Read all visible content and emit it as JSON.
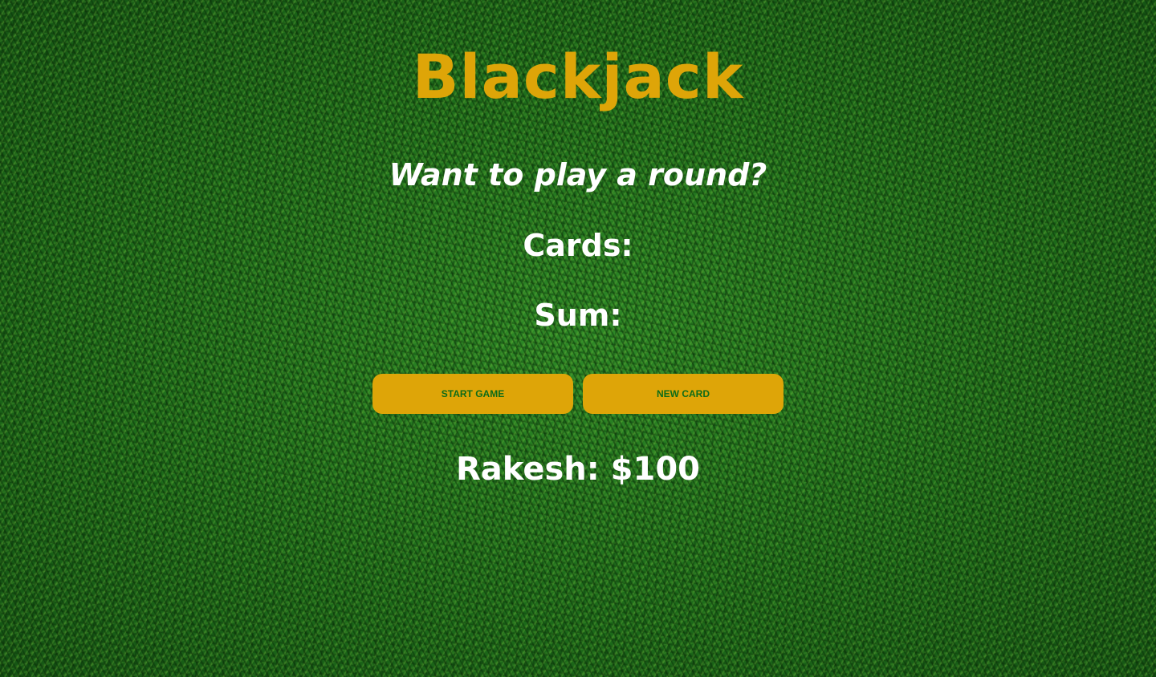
{
  "game": {
    "title": "Blackjack",
    "message": "Want to play a round?",
    "cards_label": "Cards:",
    "sum_label": "Sum:",
    "player": "Rakesh: $100"
  },
  "buttons": {
    "start_label": "START GAME",
    "new_card_label": "NEW CARD"
  },
  "colors": {
    "accent": "#dea508",
    "button_text": "#0d6b18",
    "text": "#ffffff",
    "background": "#1f6e1c"
  }
}
